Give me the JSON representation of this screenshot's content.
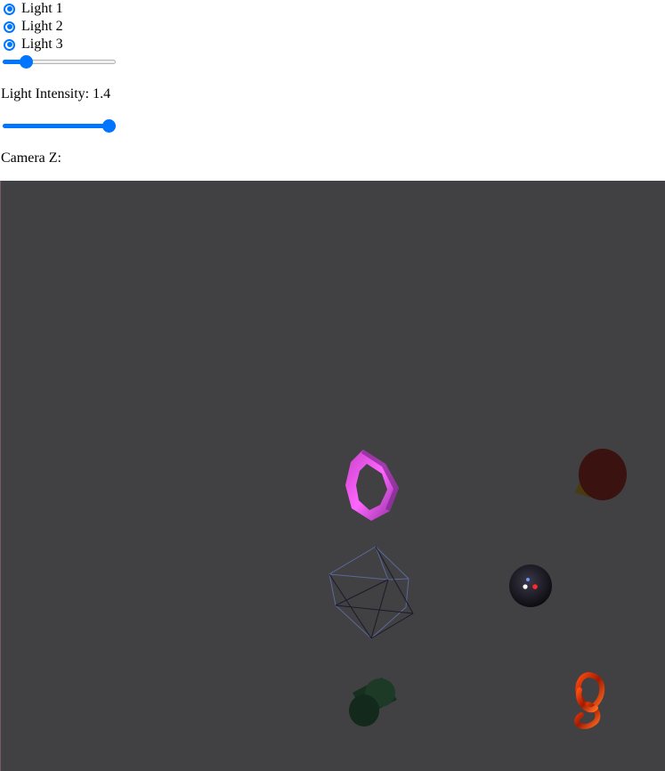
{
  "lights": [
    {
      "label": "Light 1",
      "checked": true
    },
    {
      "label": "Light 2",
      "checked": true
    },
    {
      "label": "Light 3",
      "checked": true
    }
  ],
  "intensity": {
    "label": "Light Intensity: 1.4",
    "slider_fraction": 0.17
  },
  "camera": {
    "label": "Camera Z:",
    "slider_fraction": 1.0
  },
  "scene": {
    "background": "#414042",
    "objects": [
      "hexagon-ring",
      "cone",
      "wireframe-polyhedron",
      "sphere",
      "cylinder",
      "torus-knot"
    ]
  }
}
